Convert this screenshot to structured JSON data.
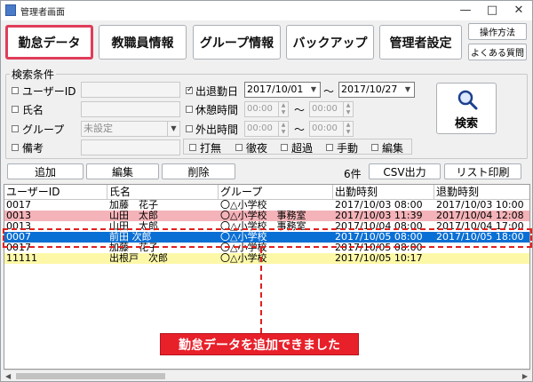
{
  "window": {
    "title": "管理者画面",
    "min_glyph": "—",
    "max_glyph": "□",
    "close_glyph": "✕"
  },
  "nav": {
    "tabs": [
      {
        "label": "勤怠データ",
        "active": true
      },
      {
        "label": "教職員情報",
        "active": false
      },
      {
        "label": "グループ情報",
        "active": false
      },
      {
        "label": "バックアップ",
        "active": false
      },
      {
        "label": "管理者設定",
        "active": false
      }
    ],
    "manual": "操作方法",
    "faq": "よくある質問"
  },
  "search": {
    "group_title": "検索条件",
    "user_id": {
      "label": "ユーザーID",
      "checked": false,
      "value": ""
    },
    "name": {
      "label": "氏名",
      "checked": false,
      "value": ""
    },
    "group": {
      "label": "グループ",
      "checked": false,
      "value": "未設定"
    },
    "note": {
      "label": "備考",
      "checked": false,
      "value": ""
    },
    "attendance_date": {
      "label": "出退勤日",
      "checked": true,
      "from": "2017/10/01",
      "to": "2017/10/27",
      "tilde": "〜"
    },
    "break_time": {
      "label": "休憩時間",
      "checked": false,
      "from": "00:00",
      "to": "00:00",
      "tilde": "〜"
    },
    "out_time": {
      "label": "外出時間",
      "checked": false,
      "from": "00:00",
      "to": "00:00",
      "tilde": "〜"
    },
    "flags": [
      {
        "label": "打無",
        "checked": false
      },
      {
        "label": "徹夜",
        "checked": false
      },
      {
        "label": "超過",
        "checked": false
      },
      {
        "label": "手動",
        "checked": false
      },
      {
        "label": "編集",
        "checked": false
      }
    ],
    "button": "検索"
  },
  "actions": {
    "add": "追加",
    "edit": "編集",
    "delete": "削除",
    "count": "6件",
    "csv": "CSV出力",
    "print": "リスト印刷"
  },
  "table": {
    "columns": [
      "ユーザーID",
      "氏名",
      "グループ",
      "出勤時刻",
      "退勤時刻"
    ],
    "rows": [
      {
        "id": "0017",
        "name": "加藤　花子",
        "group": "〇△小学校",
        "in": "2017/10/03 08:00",
        "out": "2017/10/03 10:00",
        "bg": "#ffffff",
        "fg": "#000000"
      },
      {
        "id": "0013",
        "name": "山田　太郎",
        "group": "〇△小学校　事務室",
        "in": "2017/10/03 11:39",
        "out": "2017/10/04 12:08",
        "bg": "#f4b3b8",
        "fg": "#000000"
      },
      {
        "id": "0013",
        "name": "山田　太郎",
        "group": "〇△小学校　事務室",
        "in": "2017/10/04 08:00",
        "out": "2017/10/04 17:00",
        "bg": "#ffffff",
        "fg": "#000000"
      },
      {
        "id": "0007",
        "name": "前田 次郎",
        "group": "〇△小学校",
        "in": "2017/10/05 08:00",
        "out": "2017/10/05 18:00",
        "bg": "#0a6fd4",
        "fg": "#ffffff"
      },
      {
        "id": "0017",
        "name": "加藤　花子",
        "group": "〇△小学校",
        "in": "2017/10/05 08:00",
        "out": "",
        "bg": "#ffffff",
        "fg": "#000000"
      },
      {
        "id": "11111",
        "name": "出根戸　次郎",
        "group": "〇△小学校",
        "in": "2017/10/05 10:17",
        "out": "",
        "bg": "#fdf8a8",
        "fg": "#000000"
      }
    ]
  },
  "callout": "勤怠データを追加できました",
  "colors": {
    "accent_border": "#e03c5a",
    "selected_row": "#0a6fd4",
    "alert_row": "#f4b3b8",
    "open_row": "#fdf8a8",
    "callout": "#e8202a"
  }
}
